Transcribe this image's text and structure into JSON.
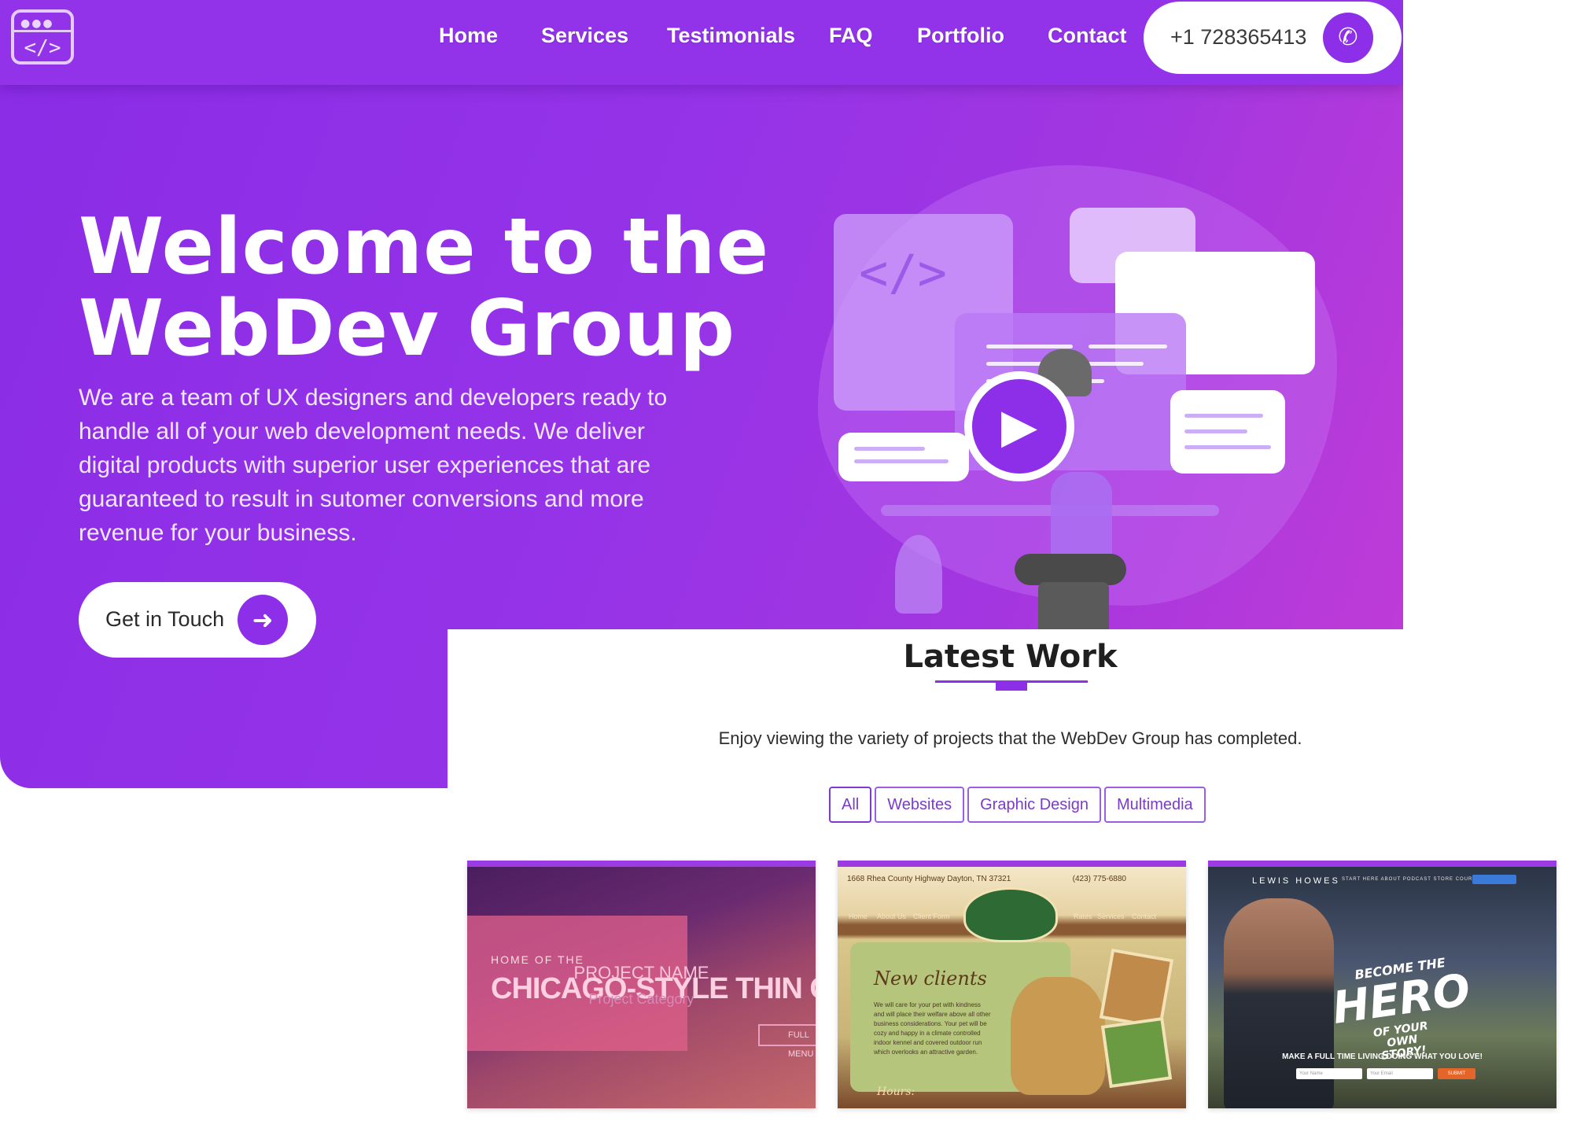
{
  "colors": {
    "brand_purple": "#8d2fe8",
    "hero_gradient_end": "#c13cd6",
    "white": "#ffffff",
    "filter_text": "#7b3bc9"
  },
  "icons": {
    "logo": "code-window-icon",
    "phone": "phone-icon",
    "cta": "arrow-right-icon",
    "illustration_play": "play-icon"
  },
  "logo": {
    "dots": "●●●",
    "code": "</>"
  },
  "nav": {
    "links": [
      {
        "label": "Home"
      },
      {
        "label": "Services"
      },
      {
        "label": "Testimonials"
      },
      {
        "label": "FAQ"
      },
      {
        "label": "Portfolio"
      },
      {
        "label": "Contact"
      }
    ],
    "phone": "+1 728365413",
    "phone_glyph": "✆"
  },
  "hero": {
    "title_line1": "Welcome to the",
    "title_line2": "WebDev Group",
    "description": "We are a team of UX designers and developers ready to handle all of your web development needs. We deliver digital products with superior user experiences that are guaranteed to result in sutomer conversions and more revenue for your business.",
    "cta_label": "Get in Touch",
    "cta_glyph": "➜",
    "illustration_code": "</>",
    "play_glyph": "▶"
  },
  "latest_work": {
    "title": "Latest Work",
    "subtitle": "Enjoy viewing the variety of projects that the WebDev Group has completed.",
    "filters": [
      {
        "label": "All",
        "active": true
      },
      {
        "label": "Websites",
        "active": false
      },
      {
        "label": "Graphic Design",
        "active": false
      },
      {
        "label": "Multimedia",
        "active": false
      }
    ],
    "projects": [
      {
        "small": "HOME OF THE",
        "big": "CHICAGO-STYLE THIN CRUST PI",
        "project_name": "PROJECT NAME",
        "project_category": "Project Category",
        "button": "FULL MENU"
      },
      {
        "address": "1668 Rhea County Highway Dayton, TN 37321",
        "phone": "(423) 775-6880",
        "nav": [
          "Home",
          "About Us",
          "Client Form",
          "Rates",
          "Services",
          "Contact"
        ],
        "script": "New clients",
        "paragraph": "We will care for your pet with kindness and will place their welfare above all other business considerations. Your pet will be cozy and happy in a climate controlled indoor kennel and covered outdoor run which overlooks an attractive garden.",
        "hours": "Hours:"
      },
      {
        "brand": "LEWIS HOWES",
        "nav": "START HERE  ABOUT  PODCAST  STORE  COURSES  CONTACT",
        "become": "BECOME THE",
        "hero": "HERO",
        "story": "OF YOUR OWN STORY!",
        "tagline": "MAKE A FULL TIME LIVING DOING WHAT YOU LOVE!",
        "name_placeholder": "Your Name",
        "email_placeholder": "Your Email",
        "submit": "SUBMIT"
      }
    ]
  }
}
